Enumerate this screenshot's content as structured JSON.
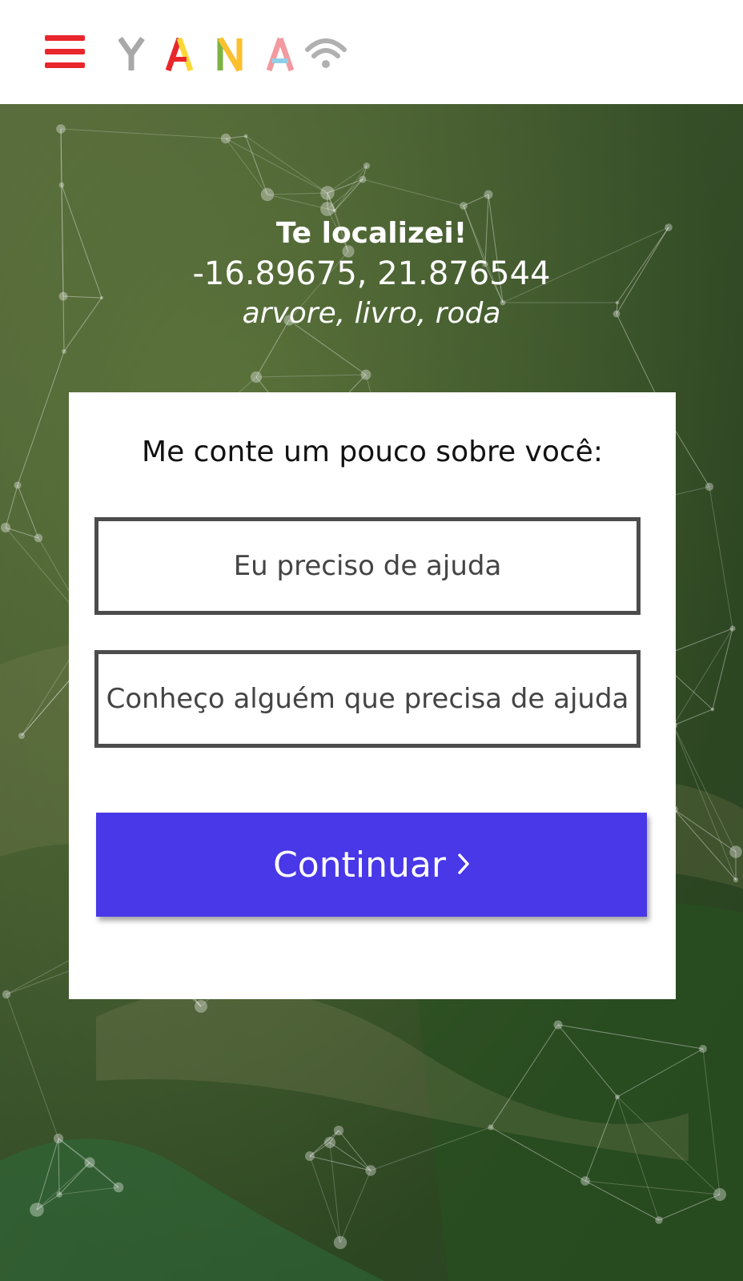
{
  "header": {
    "menu_icon": "hamburger-menu-icon",
    "logo_letters": [
      "Y",
      "A",
      "N",
      "A"
    ],
    "logo_colors": [
      "#a8a8a8",
      "#e8262b",
      "#7cb342",
      "#f29aa0"
    ],
    "logo_secondary_colors": [
      "#a8a8a8",
      "#fdd835",
      "#fbc02d",
      "#8fd0e8"
    ],
    "wifi_icon": "wifi-icon",
    "accent": "#e8262b"
  },
  "location": {
    "title": "Te localizei!",
    "coords": "-16.89675, 21.876544",
    "words": "arvore, livro, roda"
  },
  "card": {
    "title": "Me conte um pouco sobre você:",
    "options": [
      "Eu preciso de ajuda",
      "Conheço alguém que precisa de ajuda"
    ],
    "continue_label": "Continuar",
    "continue_icon": "chevron-right-icon",
    "button_color": "#4838e8"
  }
}
